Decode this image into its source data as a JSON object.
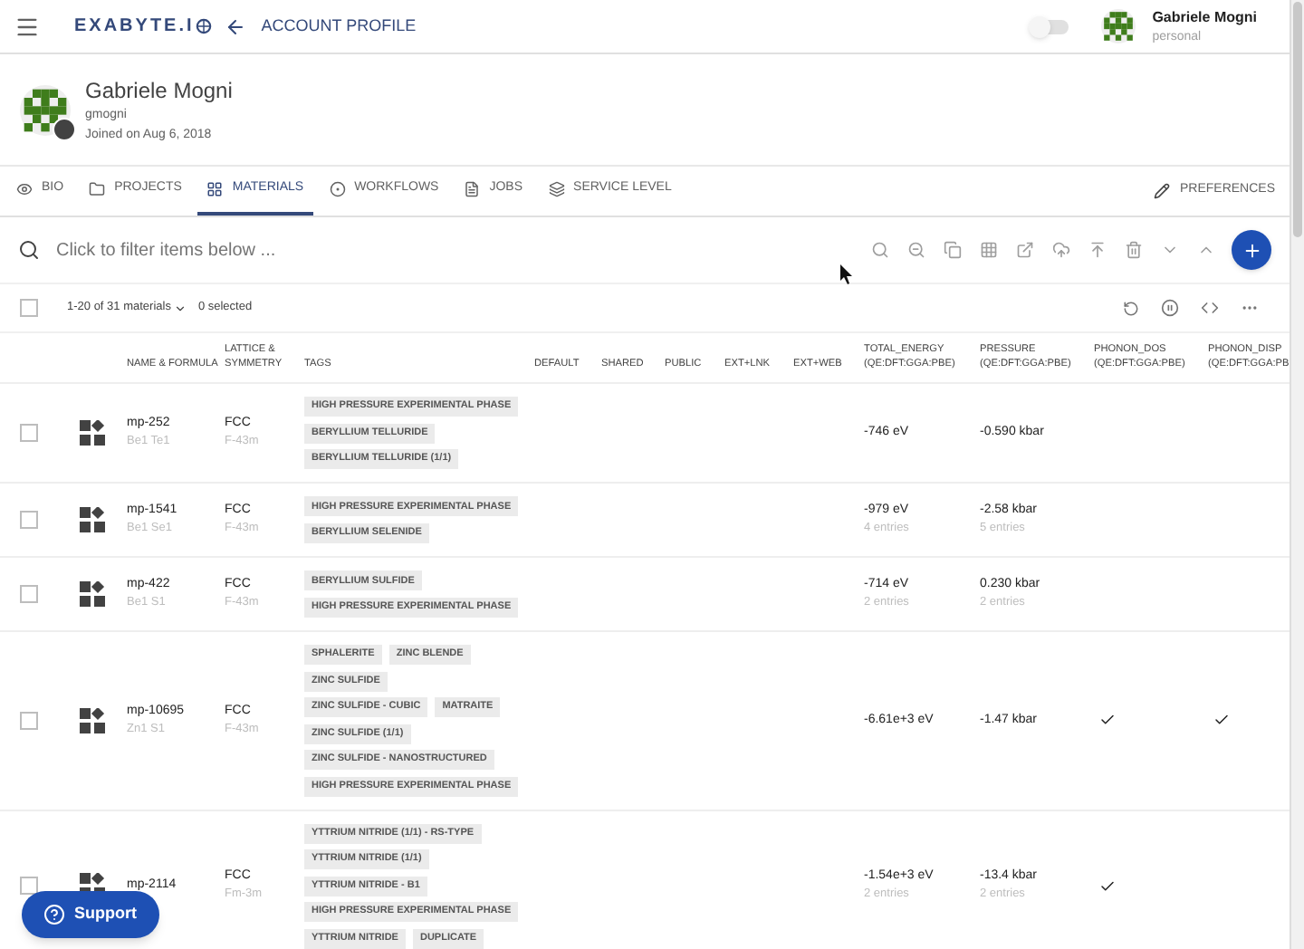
{
  "app_bar": {
    "logo": "EXABYTE.I",
    "title": "ACCOUNT PROFILE",
    "toggle_on": false,
    "user_name": "Gabriele Mogni",
    "account_type": "personal"
  },
  "profile": {
    "name": "Gabriele Mogni",
    "username": "gmogni",
    "joined": "Joined on Aug 6, 2018"
  },
  "tabs": [
    {
      "label": "BIO",
      "selected": false
    },
    {
      "label": "PROJECTS",
      "selected": false
    },
    {
      "label": "MATERIALS",
      "selected": true
    },
    {
      "label": "WORKFLOWS",
      "selected": false
    },
    {
      "label": "JOBS",
      "selected": false
    },
    {
      "label": "SERVICE LEVEL",
      "selected": false
    }
  ],
  "preferences": {
    "label": "PREFERENCES"
  },
  "filter": {
    "placeholder": "Click to filter items below ..."
  },
  "selection_bar": {
    "checked": false,
    "range": "1-20 of 31 materials",
    "selected_count": "0 selected"
  },
  "table": {
    "columns": [
      "NAME & FORMULA",
      "LATTICE &\nSYMMETRY",
      "TAGS",
      "DEFAULT",
      "SHARED",
      "PUBLIC",
      "EXT+LNK",
      "EXT+WEB",
      "TOTAL_ENERGY\n(QE:DFT:GGA:PBE)",
      "PRESSURE\n(QE:DFT:GGA:PBE)",
      "PHONON_DOS\n(QE:DFT:GGA:PBE)",
      "PHONON_DISP\n(QE:DFT:GGA:PB"
    ],
    "rows": [
      {
        "checked": false,
        "name": "mp-252",
        "formula": "Be1 Te1",
        "lattice": "FCC",
        "symmetry": "F-43m",
        "tags": [
          "HIGH PRESSURE EXPERIMENTAL PHASE",
          "BERYLLIUM TELLURIDE",
          "BERYLLIUM TELLURIDE (1/1)"
        ],
        "total_energy": "-746 eV",
        "pressure": "-0.590 kbar",
        "phonon_dos": false,
        "phonon_disp": false
      },
      {
        "checked": false,
        "name": "mp-1541",
        "formula": "Be1 Se1",
        "lattice": "FCC",
        "symmetry": "F-43m",
        "tags": [
          "HIGH PRESSURE EXPERIMENTAL PHASE",
          "BERYLLIUM SELENIDE"
        ],
        "total_energy": "-979 eV",
        "energy_entries": "4 entries",
        "pressure": "-2.58 kbar",
        "pressure_entries": "5 entries",
        "phonon_dos": false,
        "phonon_disp": false
      },
      {
        "checked": false,
        "name": "mp-422",
        "formula": "Be1 S1",
        "lattice": "FCC",
        "symmetry": "F-43m",
        "tags": [
          "BERYLLIUM SULFIDE",
          "HIGH PRESSURE EXPERIMENTAL PHASE"
        ],
        "total_energy": "-714 eV",
        "energy_entries": "2 entries",
        "pressure": "0.230 kbar",
        "pressure_entries": "2 entries",
        "phonon_dos": false,
        "phonon_disp": false
      },
      {
        "checked": false,
        "name": "mp-10695",
        "formula": "Zn1 S1",
        "lattice": "FCC",
        "symmetry": "F-43m",
        "tags": [
          [
            "SPHALERITE",
            "ZINC BLENDE"
          ],
          [
            "ZINC SULFIDE"
          ],
          [
            "ZINC SULFIDE - CUBIC",
            "MATRAITE"
          ],
          [
            "ZINC SULFIDE (1/1)"
          ],
          [
            "ZINC SULFIDE - NANOSTRUCTURED"
          ],
          [
            "HIGH PRESSURE EXPERIMENTAL PHASE"
          ]
        ],
        "total_energy": "-6.61e+3 eV",
        "pressure": "-1.47 kbar",
        "phonon_dos": true,
        "phonon_disp": true
      },
      {
        "checked": false,
        "name": "mp-2114",
        "lattice": "FCC",
        "symmetry": "Fm-3m",
        "tags": [
          [
            "YTTRIUM NITRIDE (1/1) - RS-TYPE"
          ],
          [
            "YTTRIUM NITRIDE (1/1)"
          ],
          [
            "YTTRIUM NITRIDE - B1"
          ],
          [
            "HIGH PRESSURE EXPERIMENTAL PHASE"
          ],
          [
            "YTTRIUM NITRIDE",
            "DUPLICATE"
          ]
        ],
        "total_energy": "-1.54e+3 eV",
        "energy_entries": "2 entries",
        "pressure": "-13.4 kbar",
        "pressure_entries": "2 entries",
        "phonon_dos": true,
        "phonon_disp": false
      }
    ]
  },
  "support_button": {
    "label": "Support"
  }
}
